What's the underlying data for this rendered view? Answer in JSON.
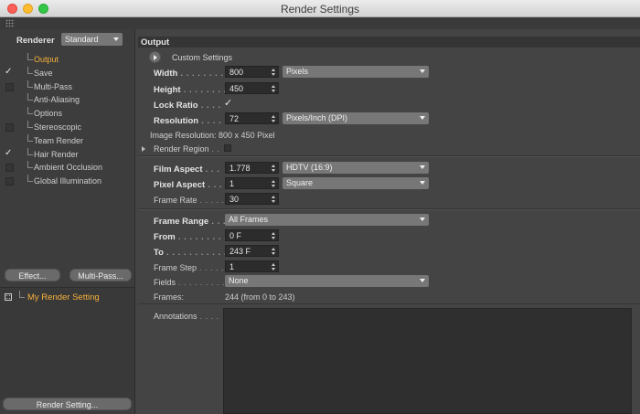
{
  "window": {
    "title": "Render Settings"
  },
  "sidebar": {
    "renderer_label": "Renderer",
    "renderer_value": "Standard",
    "items": [
      {
        "label": "Output",
        "state": "none",
        "active": true
      },
      {
        "label": "Save",
        "state": "checked",
        "active": false
      },
      {
        "label": "Multi-Pass",
        "state": "unchecked",
        "active": false
      },
      {
        "label": "Anti-Aliasing",
        "state": "none",
        "active": false
      },
      {
        "label": "Options",
        "state": "none",
        "active": false
      },
      {
        "label": "Stereoscopic",
        "state": "unchecked",
        "active": false
      },
      {
        "label": "Team Render",
        "state": "none",
        "active": false
      },
      {
        "label": "Hair Render",
        "state": "checked",
        "active": false
      },
      {
        "label": "Ambient Occlusion",
        "state": "unchecked",
        "active": false
      },
      {
        "label": "Global Illumination",
        "state": "unchecked",
        "active": false
      }
    ],
    "effect_button": "Effect...",
    "multipass_button": "Multi-Pass...",
    "render_setting_name": "My Render Setting",
    "render_setting_button": "Render Setting..."
  },
  "output": {
    "section_title": "Output",
    "custom_settings": "Custom Settings",
    "width": {
      "label": "Width",
      "dots": " . . . . . . . .",
      "value": "800",
      "unit": "Pixels"
    },
    "height": {
      "label": "Height",
      "dots": " . . . . . . . .",
      "value": "450"
    },
    "lock_ratio": {
      "label": "Lock Ratio",
      "dots": " . . . .",
      "mark": "✓"
    },
    "resolution": {
      "label": "Resolution",
      "dots": " . . . .",
      "value": "72",
      "unit": "Pixels/Inch (DPI)"
    },
    "image_resolution": "Image Resolution: 800 x 450 Pixel",
    "render_region": {
      "label": "Render Region",
      "dots": " . ."
    },
    "film_aspect": {
      "label": "Film Aspect",
      "dots": " . . .",
      "value": "1.778",
      "preset": "HDTV (16:9)"
    },
    "pixel_aspect": {
      "label": "Pixel Aspect",
      "dots": " . . .",
      "value": "1",
      "preset": "Square"
    },
    "frame_rate": {
      "label": "Frame Rate",
      "dots": " . . . . .",
      "value": "30"
    },
    "frame_range": {
      "label": "Frame Range",
      "dots": " . . .",
      "value": "All Frames"
    },
    "from": {
      "label": "From",
      "dots": " . . . . . . . . . . .",
      "value": "0 F"
    },
    "to": {
      "label": "To",
      "dots": " . . . . . . . . . . . . .",
      "value": "243 F"
    },
    "frame_step": {
      "label": "Frame Step",
      "dots": " . . . . .",
      "value": "1"
    },
    "fields": {
      "label": "Fields",
      "dots": " . . . . . . . . .",
      "value": "None"
    },
    "frames": {
      "label": "Frames:",
      "value": "244 (from 0 to 243)"
    },
    "annotations": {
      "label": "Annotations",
      "dots": " . . . ."
    }
  },
  "icons": {
    "renderer_dropdown": "chevron-down-icon",
    "custom_settings": "play-arrow-icon",
    "spinner": "spinner-arrows-icon",
    "tree_check": "checkmark-icon",
    "render_setting": "render-setting-icon"
  },
  "colors": {
    "active_item": "#f6b13a",
    "panel_bg": "#444444",
    "sidebar_bg": "#3d3d3d",
    "field_bg": "#2c2c2c",
    "dropdown_bg": "#777777"
  }
}
